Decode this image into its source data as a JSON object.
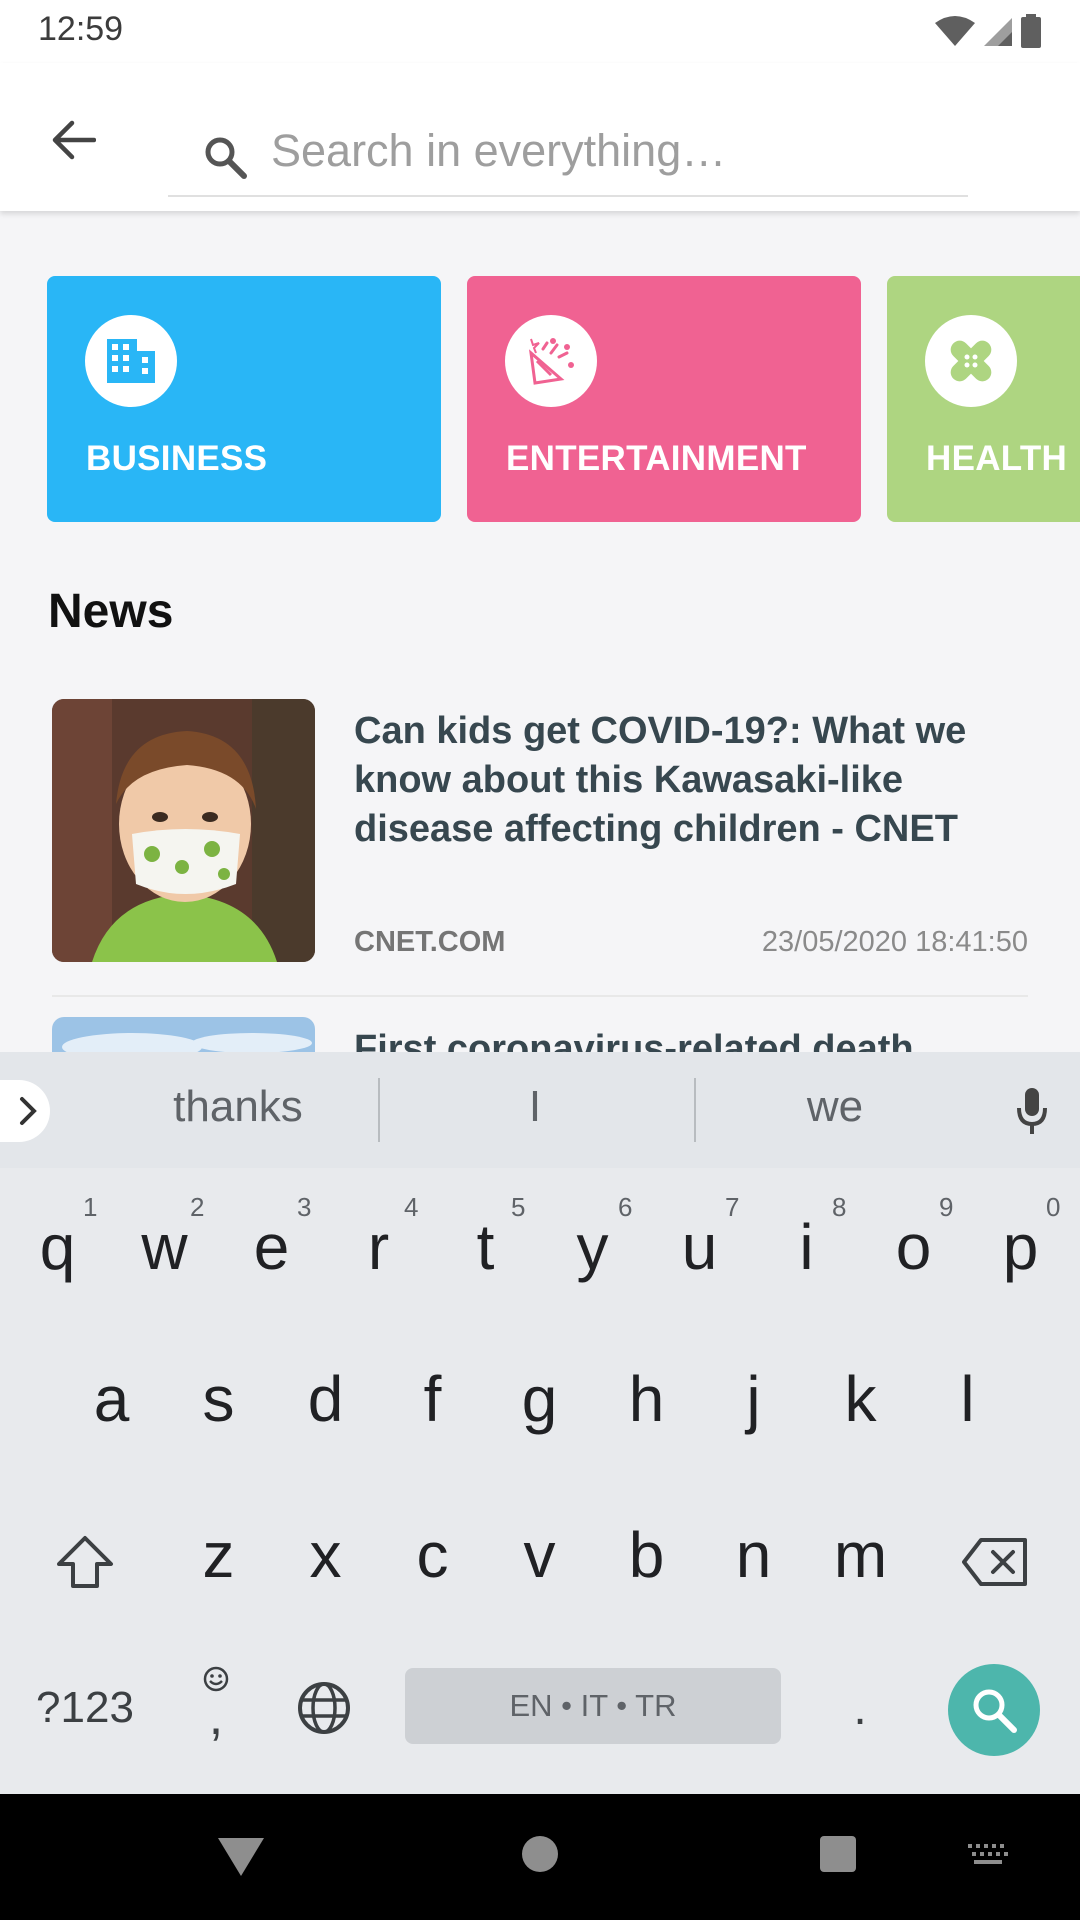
{
  "status": {
    "time": "12:59"
  },
  "search": {
    "placeholder": "Search in everything…"
  },
  "categories": [
    {
      "label": "BUSINESS",
      "color": "#29b6f6",
      "icon": "building-icon"
    },
    {
      "label": "ENTERTAINMENT",
      "color": "#f06292",
      "icon": "party-popper-icon"
    },
    {
      "label": "HEALTH",
      "color": "#aed581",
      "icon": "bandage-icon"
    }
  ],
  "news": {
    "title": "News",
    "items": [
      {
        "title": "Can kids get COVID-19?: What we know about this Kawasaki-like disease affecting children - CNET",
        "source": "CNET.COM",
        "date": "23/05/2020 18:41:50"
      },
      {
        "title": "First coronavirus-related death",
        "source": "",
        "date": ""
      }
    ]
  },
  "keyboard": {
    "suggestions": [
      "thanks",
      "I",
      "we"
    ],
    "row1": [
      "q",
      "w",
      "e",
      "r",
      "t",
      "y",
      "u",
      "i",
      "o",
      "p"
    ],
    "row1_hints": [
      "1",
      "2",
      "3",
      "4",
      "5",
      "6",
      "7",
      "8",
      "9",
      "0"
    ],
    "row2": [
      "a",
      "s",
      "d",
      "f",
      "g",
      "h",
      "j",
      "k",
      "l"
    ],
    "row3": [
      "z",
      "x",
      "c",
      "v",
      "b",
      "n",
      "m"
    ],
    "symbols_label": "?123",
    "comma": ",",
    "period": ".",
    "space_label": "EN • IT • TR"
  }
}
